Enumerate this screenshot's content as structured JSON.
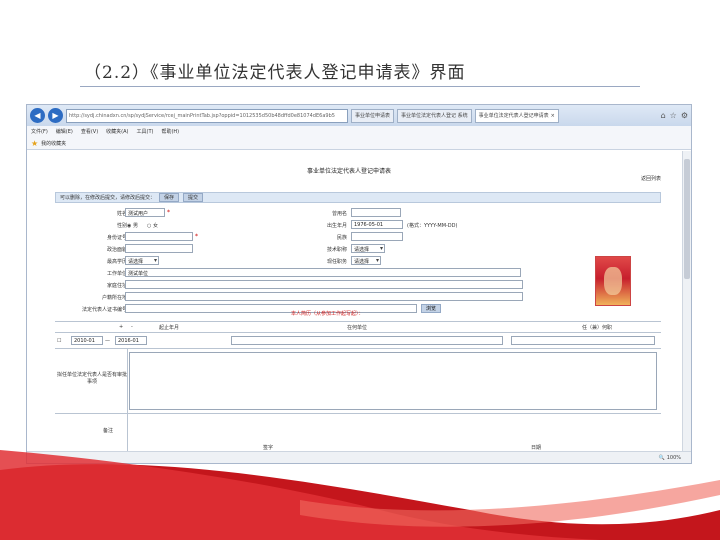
{
  "slide": {
    "title": "（2.2）《事业单位法定代表人登记申请表》界面"
  },
  "browser": {
    "url": "http://sydj.chinadxn.cn/sp/sydjService/rcej_mainPrintTab.jsp?oppid=1012535d50b48dffd0e81074dE6a9b5",
    "tabs": [
      "事业单位申请表",
      "事业单位法定代表人登记 系统",
      "事业单位法定代表人登记申请表"
    ],
    "menu": [
      "文件(F)",
      "编辑(E)",
      "查看(V)",
      "收藏夹(A)",
      "工具(T)",
      "帮助(H)"
    ],
    "favorites_label": "我的收藏夹",
    "status_zoom": "100%"
  },
  "form": {
    "title": "事业单位法定代表人登记申请表",
    "return_label": "返回列表",
    "toolbar_label": "可以删除，在修改后提交，请修改后提交：",
    "toolbar_btn1": "保存",
    "toolbar_btn2": "提交",
    "labels": {
      "name": "姓名",
      "gender": "性别",
      "id_number": "身份证号",
      "political": "政治面貌",
      "education": "最高学历",
      "work_unit": "工作单位",
      "address": "家庭住址",
      "household": "户籍所在地",
      "cert": "法定代表人证书编号",
      "former_name": "曾用名",
      "birth": "出生年月",
      "nation": "民族",
      "degree": "技术职称",
      "post": "现任职务",
      "from_to": "起止年月",
      "work_desc": "在何单位",
      "role": "任（兼）何职",
      "intent": "拟任单位法定代表人是否有审批事项",
      "sign": "签字",
      "date": "日期"
    },
    "values": {
      "name": "测试用户",
      "male": "男",
      "female": "女",
      "birth": "1976-05-01",
      "birth_hint": "(格式：YYYY-MM-DD)",
      "select_default": "请选择",
      "work_unit": "测试单位",
      "browse": "浏览",
      "date_start": "2010-01",
      "date_end": "2016-01"
    },
    "history_title": "本人简历（从参加工作起写起）：",
    "history_add": "+",
    "history_remove": "-",
    "remark_label": "备注"
  }
}
